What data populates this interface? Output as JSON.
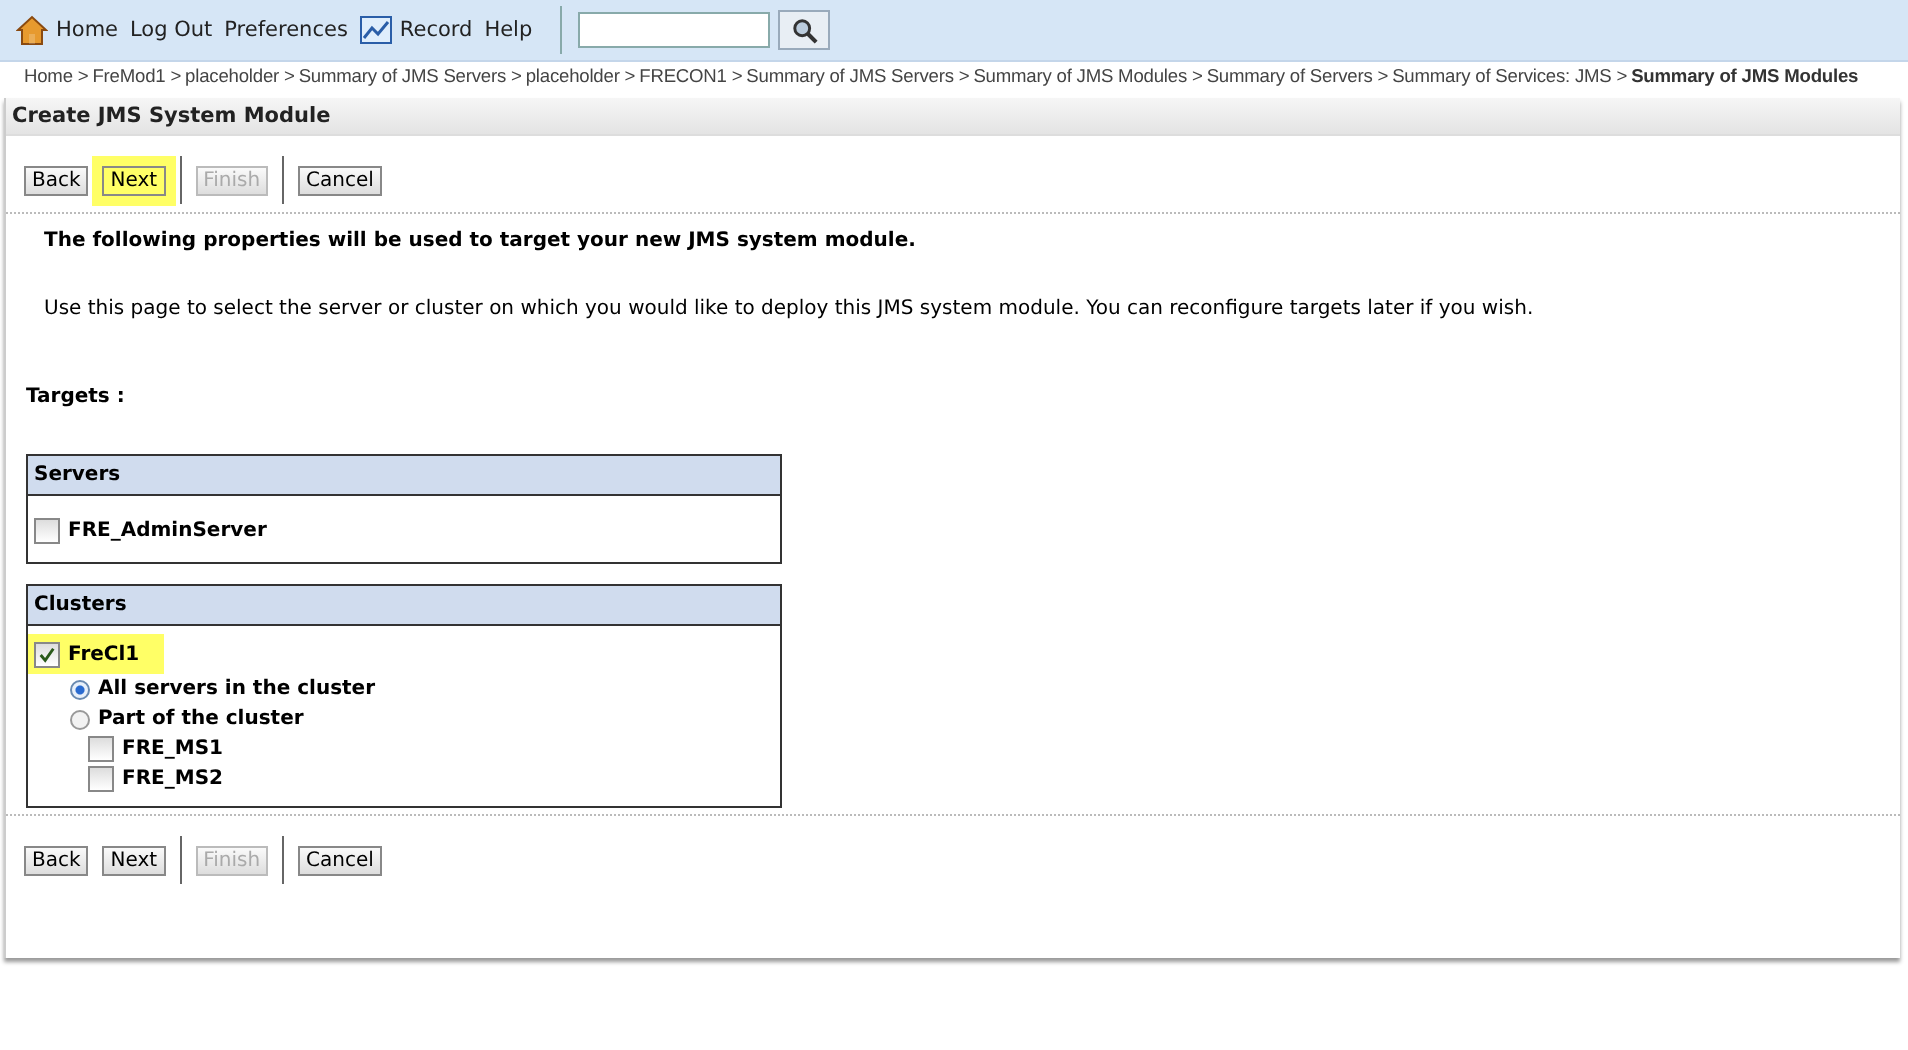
{
  "toolbar": {
    "links": [
      {
        "kind": "home",
        "label": "Home"
      },
      {
        "kind": "plain",
        "label": "Log Out"
      },
      {
        "kind": "plain",
        "label": "Preferences"
      },
      {
        "kind": "record",
        "label": "Record"
      },
      {
        "kind": "plain",
        "label": "Help"
      }
    ]
  },
  "breadcrumb": [
    {
      "label": "Home >",
      "current": false
    },
    {
      "label": "FreMod1 >",
      "current": false
    },
    {
      "label": "placeholder >",
      "current": false
    },
    {
      "label": "Summary of JMS Servers >",
      "current": false
    },
    {
      "label": "placeholder >",
      "current": false
    },
    {
      "label": "FRECON1 >",
      "current": false
    },
    {
      "label": "Summary of JMS Servers >",
      "current": false
    },
    {
      "label": "Summary of JMS Modules >",
      "current": false
    },
    {
      "label": "Summary of Servers >",
      "current": false
    },
    {
      "label": "Summary of Services: JMS >",
      "current": false
    },
    {
      "label": "Summary of JMS Modules",
      "current": true
    }
  ],
  "title": "Create JMS System Module",
  "top_buttons": [
    {
      "label": "Back",
      "disabled": false,
      "highlighted": false
    },
    {
      "label": "Next",
      "disabled": false,
      "highlighted": true
    },
    {
      "label": "Finish",
      "disabled": true,
      "highlighted": false
    },
    {
      "label": "Cancel",
      "disabled": false,
      "highlighted": false
    }
  ],
  "intro": "The following properties will be used to target your new JMS system module.",
  "description": "Use this page to select the server or cluster on which you would like to deploy this JMS system module. You can reconfigure targets later if you wish.",
  "targets_label": "Targets :",
  "servers": {
    "heading": "Servers",
    "items": [
      {
        "label": "FRE_AdminServer",
        "checked": false
      }
    ]
  },
  "clusters": {
    "heading": "Clusters",
    "items": [
      {
        "label": "FreCl1",
        "checked": true,
        "highlighted": true,
        "options": [
          {
            "label": "All servers in the cluster",
            "selected": true
          },
          {
            "label": "Part of the cluster",
            "selected": false
          }
        ],
        "members": [
          {
            "label": "FRE_MS1",
            "checked": false
          },
          {
            "label": "FRE_MS2",
            "checked": false
          }
        ]
      }
    ]
  },
  "bottom_buttons": [
    {
      "label": "Back",
      "disabled": false,
      "highlighted": false
    },
    {
      "label": "Next",
      "disabled": false,
      "highlighted": false
    },
    {
      "label": "Finish",
      "disabled": true,
      "highlighted": false
    },
    {
      "label": "Cancel",
      "disabled": false,
      "highlighted": false
    }
  ]
}
